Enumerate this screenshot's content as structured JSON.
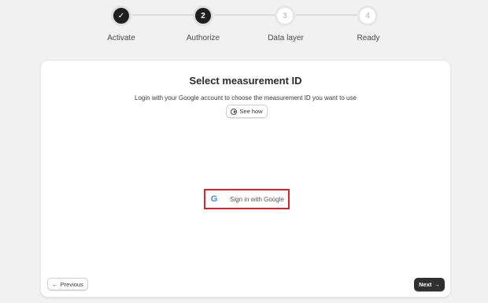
{
  "stepper": {
    "steps": [
      {
        "label": "Activate",
        "marker": "✓",
        "state": "done"
      },
      {
        "label": "Authorize",
        "marker": "2",
        "state": "active"
      },
      {
        "label": "Data layer",
        "marker": "3",
        "state": "pending"
      },
      {
        "label": "Ready",
        "marker": "4",
        "state": "pending"
      }
    ]
  },
  "card": {
    "title": "Select measurement ID",
    "subtitle": "Login with your Google account to choose the measurement ID you want to use",
    "see_how_label": "See how",
    "google_button_label": "Sign in with Google",
    "google_icon_letter": "G"
  },
  "footer": {
    "previous_label": "Previous",
    "previous_arrow": "←",
    "next_label": "Next",
    "next_arrow": "→"
  },
  "colors": {
    "highlight": "#e01f26",
    "primary_dark": "#303030",
    "google_blue": "#4285f4"
  }
}
